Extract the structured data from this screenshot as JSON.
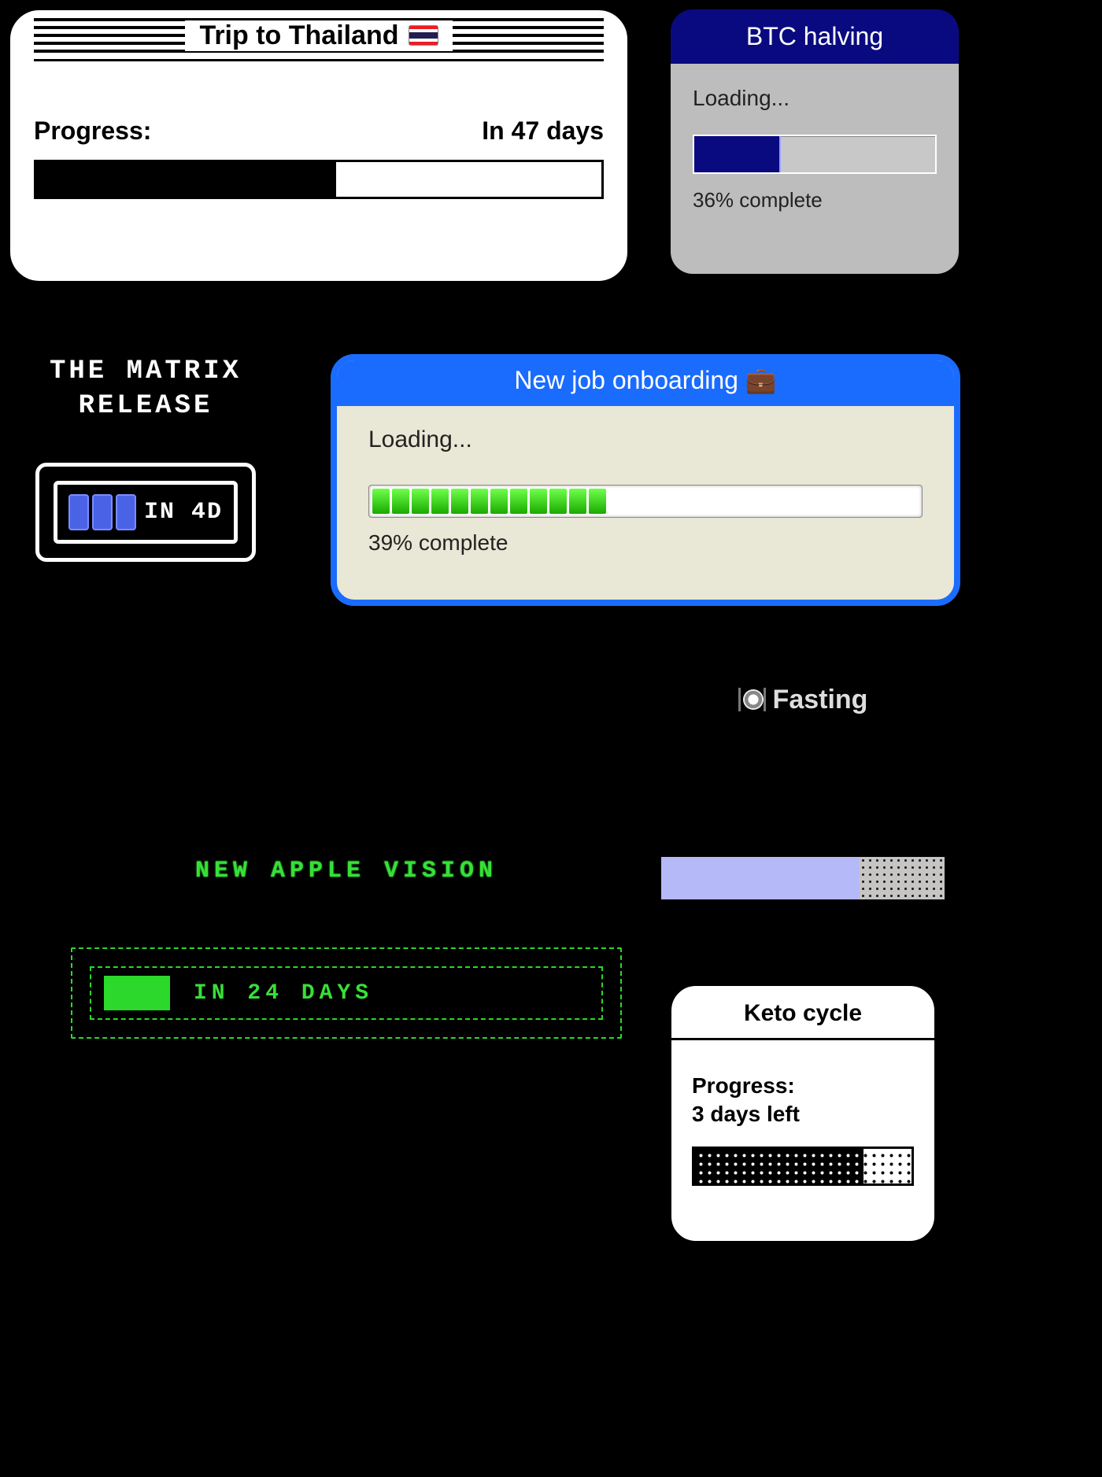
{
  "thailand": {
    "title": "Trip to Thailand",
    "progress_label": "Progress:",
    "countdown": "In 47 days",
    "progress_pct": 53
  },
  "btc": {
    "title": "BTC halving",
    "loading": "Loading...",
    "pct_text": "36% complete",
    "progress_pct": 36
  },
  "matrix": {
    "title": "THE MATRIX\nRELEASE",
    "inside": "IN 4D",
    "blocks": 3
  },
  "job": {
    "title": "New job onboarding 💼",
    "loading": "Loading...",
    "pct_text": "39% complete",
    "progress_pct": 39,
    "segments": 12
  },
  "fasting": {
    "title": "Fasting",
    "progress_pct": 70
  },
  "vision": {
    "title": "NEW APPLE VISION",
    "countdown": "IN 24 DAYS",
    "progress_pct": 14
  },
  "keto": {
    "title": "Keto cycle",
    "progress_label": "Progress:",
    "days_left": "3 days left",
    "progress_pct": 78
  }
}
